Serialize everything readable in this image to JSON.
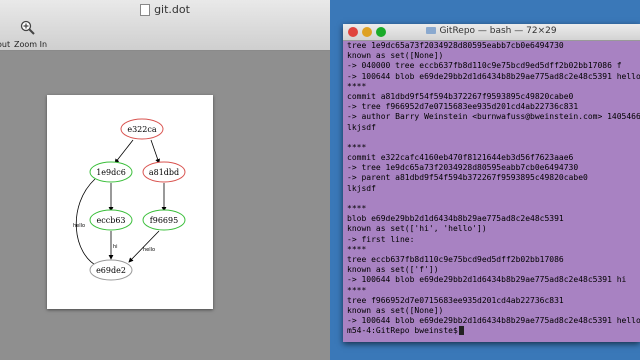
{
  "preview": {
    "document_title": "git.dot",
    "toolbar": {
      "zoom_out_label": "out",
      "zoom_in_label": "Zoom In"
    },
    "graph": {
      "nodes": [
        {
          "id": "e322ca",
          "color": "#d9534f"
        },
        {
          "id": "1e9dc6",
          "color": "#3bbf3b"
        },
        {
          "id": "a81dbd",
          "color": "#d9534f"
        },
        {
          "id": "eccb63",
          "color": "#3bbf3b"
        },
        {
          "id": "f96695",
          "color": "#3bbf3b"
        },
        {
          "id": "e69de2",
          "color": "#999999"
        }
      ],
      "edge_labels": {
        "hello_left": "hello",
        "hi": "hi",
        "hello_right": "hello"
      }
    }
  },
  "terminal": {
    "title": "GitRepo — bash — 72×29",
    "prompt": "m54-4:GitRepo bweinste$",
    "lines": [
      "tree 1e9dc65a73f2034928d80595eabb7cb0e6494730",
      "known as set([None])",
      "-> 040000 tree eccb637fb8d110c9e75bcd9ed5dff2b02bb17086 f",
      "-> 100644 blob e69de29bb2d1d6434b8b29ae775ad8c2e48c5391 hello",
      "****",
      "commit a81dbd9f54f594b372267f9593895c49820cabe0",
      "-> tree f966952d7e0715683ee935d201cd4ab22736c831",
      "-> author Barry Weinstein <burnwafuss@bweinstein.com> 1405466",
      "lkjsdf",
      "",
      "****",
      "commit e322cafc4160eb470f8121644eb3d56f7623aae6",
      "-> tree 1e9dc65a73f2034928d80595eabb7cb0e6494730",
      "-> parent a81dbd9f54f594b372267f9593895c49820cabe0",
      "lkjsdf",
      "",
      "****",
      "blob e69de29bb2d1d6434b8b29ae775ad8c2e48c5391",
      "known as set(['hi', 'hello'])",
      "-> first line:",
      "****",
      "tree eccb637fb8d110c9e75bcd9ed5dff2b02bb17086",
      "known as set(['f'])",
      "-> 100644 blob e69de29bb2d1d6434b8b29ae775ad8c2e48c5391 hi",
      "****",
      "tree f966952d7e0715683ee935d201cd4ab22736c831",
      "known as set([None])",
      "-> 100644 blob e69de29bb2d1d6434b8b29ae775ad8c2e48c5391 hello"
    ]
  }
}
